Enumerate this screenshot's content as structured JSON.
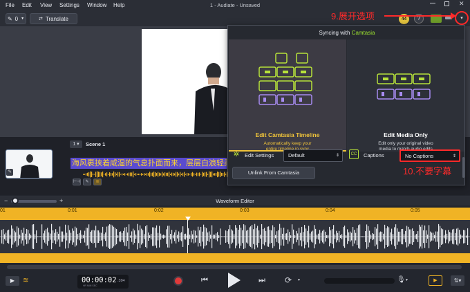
{
  "menu": [
    "File",
    "Edit",
    "View",
    "Settings",
    "Window",
    "Help"
  ],
  "window_title": "1 - Audiate - Unsaved",
  "toolbar": {
    "edit_count": "0",
    "translate_label": "Translate",
    "badge_count": "44"
  },
  "scene": {
    "number": "1",
    "label": "Scene 1",
    "caption": "海风裹挟着咸湿的气息扑面而来，层层白浪轻柔"
  },
  "panel": {
    "title_prefix": "Syncing with ",
    "title_brand": "Camtasia",
    "left_card": {
      "heading": "Edit Camtasia Timeline",
      "desc_line1": "Automatically keep your",
      "desc_line2": "entire timeline in sync"
    },
    "right_card": {
      "heading": "Edit Media Only",
      "desc_line1": "Edit only your original video",
      "desc_line2": "media to match audio edits"
    },
    "edit_settings_label": "Edit Settings",
    "edit_settings_value": "Default",
    "captions_label": "Captions",
    "captions_value": "No Captions",
    "unlink_label": "Unlink From Camtasia"
  },
  "waveform": {
    "title": "Waveform Editor",
    "ticks": [
      "01",
      "0:01",
      "0:02",
      "0:03",
      "0:04",
      "0:05"
    ]
  },
  "transport": {
    "time": "00:00:02",
    "frames": ".394",
    "time_units": "HR  MIN  SEC"
  },
  "annotations": {
    "step9": "9.展开选项",
    "step10": "10.不要字幕"
  },
  "colors": {
    "accent_green": "#9be12f",
    "timeline_yellow": "#f0b325",
    "caption_bg": "#5a4bd0",
    "annotation_red": "#ff2a2a"
  }
}
